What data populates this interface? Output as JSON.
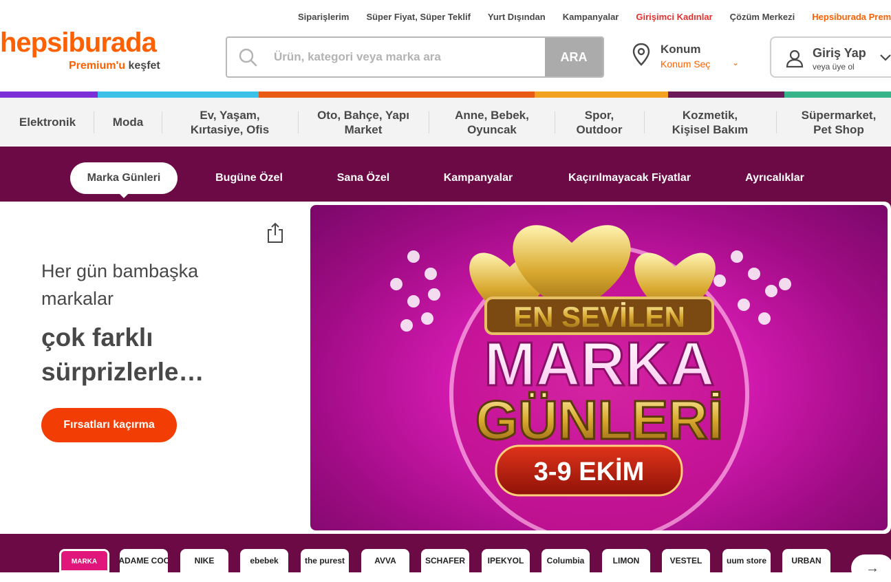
{
  "toplinks": [
    {
      "label": "Siparişlerim",
      "tone": "normal"
    },
    {
      "label": "Süper Fiyat, Süper Teklif",
      "tone": "normal"
    },
    {
      "label": "Yurt Dışından",
      "tone": "normal"
    },
    {
      "label": "Kampanyalar",
      "tone": "normal"
    },
    {
      "label": "Girişimci Kadınlar",
      "tone": "red"
    },
    {
      "label": "Çözüm Merkezi",
      "tone": "normal"
    },
    {
      "label": "Hepsiburada Premium",
      "tone": "orange"
    }
  ],
  "logo": {
    "text": "hepsiburada",
    "sub_accent": "Premium'u",
    "sub_rest": "keşfet"
  },
  "search": {
    "placeholder": "Ürün, kategori veya marka ara",
    "button": "ARA",
    "icon": "search-icon"
  },
  "location": {
    "title": "Konum",
    "subtitle": "Konum Seç",
    "icon": "location-pin-icon"
  },
  "login": {
    "title": "Giriş Yap",
    "subtitle": "veya üye ol",
    "icon": "user-icon"
  },
  "colorbar": [
    "#7b2fd6",
    "#3bc1e8",
    "#e95b14",
    "#f3a21f",
    "#6c1a57",
    "#37b48a"
  ],
  "categories": [
    "Elektronik",
    "Moda",
    "Ev, Yaşam,\nKırtasiye, Ofis",
    "Oto, Bahçe, Yapı\nMarket",
    "Anne, Bebek,\nOyuncak",
    "Spor,\nOutdoor",
    "Kozmetik,\nKişisel Bakım",
    "Süpermarket,\nPet Shop"
  ],
  "tabs": [
    "Marka Günleri",
    "Bugüne Özel",
    "Sana Özel",
    "Kampanyalar",
    "Kaçırılmayacak Fiyatlar",
    "Ayrıcalıklar"
  ],
  "hero": {
    "line1": "Her gün bambaşka markalar",
    "line2": "çok farklı sürprizlerle…",
    "cta": "Fırsatları kaçırma",
    "banner": {
      "top": "EN SEVİLEN",
      "mid": "MARKA",
      "big": "GÜNLERİ",
      "dates": "3-9 EKİM"
    }
  },
  "brands": [
    "MARKA",
    "MADAME COCO",
    "NIKE",
    "ebebek",
    "the purest",
    "AVVA",
    "SCHAFER",
    "IPEKYOL",
    "Columbia",
    "LIMON",
    "VESTEL",
    "uum store",
    "URBAN"
  ],
  "colors": {
    "brand_orange": "#ff6000",
    "hero_bg": "#6c0a45",
    "cta": "#f23d04"
  }
}
